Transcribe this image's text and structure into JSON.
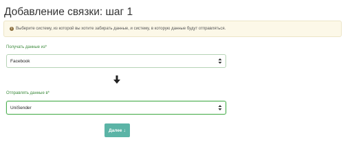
{
  "page": {
    "title": "Добавление связки: шаг 1"
  },
  "alert": {
    "icon": "info-icon",
    "text": "Выберите систему, из которой вы хотите забирать данные, и систему, в которую данные будут отправляться."
  },
  "source": {
    "label": "Получать данные из*",
    "selected": "Facebook"
  },
  "direction": {
    "icon": "arrow-down-icon"
  },
  "target": {
    "label": "Отправлять данные в*",
    "selected": "UniSender"
  },
  "actions": {
    "next_label": "Далее",
    "next_icon": "↓",
    "button_color": "#5bb4a6"
  },
  "colors": {
    "label_green": "#3c8a3c",
    "focus_border": "#4caf50",
    "alert_bg": "#fcf8e8"
  }
}
